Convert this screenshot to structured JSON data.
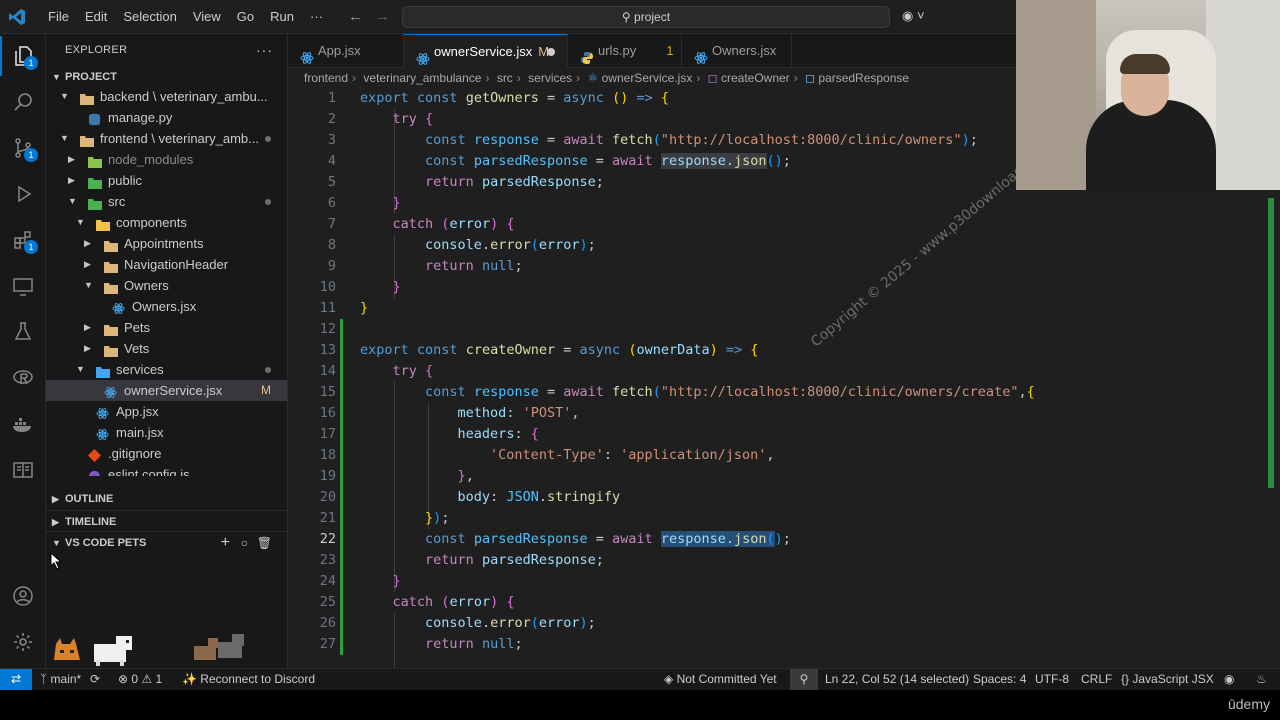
{
  "menu": {
    "items": [
      "File",
      "Edit",
      "Selection",
      "View",
      "Go",
      "Run"
    ],
    "more": "···"
  },
  "search": {
    "text": "project"
  },
  "colors": {
    "accent": "#0078d4",
    "git_added": "#2ea043",
    "modified": "#e2c08d"
  },
  "explorer": {
    "title": "EXPLORER",
    "more": "···",
    "project_section": "PROJECT",
    "outline": "OUTLINE",
    "timeline": "TIMELINE",
    "pets": "VS CODE PETS",
    "tree": [
      {
        "label": "backend \\ veterinary_ambu...",
        "depth": 0,
        "kind": "folder-open",
        "icon": "folder-icon"
      },
      {
        "label": "manage.py",
        "depth": 1,
        "kind": "file",
        "icon": "python-icon"
      },
      {
        "label": "frontend \\ veterinary_amb...",
        "depth": 0,
        "kind": "folder-open",
        "icon": "folder-icon"
      },
      {
        "label": "node_modules",
        "depth": 1,
        "kind": "folder-closed",
        "icon": "folder-node-icon"
      },
      {
        "label": "public",
        "depth": 1,
        "kind": "folder-closed",
        "icon": "folder-public-icon"
      },
      {
        "label": "src",
        "depth": 1,
        "kind": "folder-open",
        "icon": "folder-src-icon"
      },
      {
        "label": "components",
        "depth": 2,
        "kind": "folder-open",
        "icon": "folder-components-icon"
      },
      {
        "label": "Appointments",
        "depth": 3,
        "kind": "folder-closed",
        "icon": "folder-icon"
      },
      {
        "label": "NavigationHeader",
        "depth": 3,
        "kind": "folder-closed",
        "icon": "folder-icon"
      },
      {
        "label": "Owners",
        "depth": 3,
        "kind": "folder-open",
        "icon": "folder-icon"
      },
      {
        "label": "Owners.jsx",
        "depth": 4,
        "kind": "file",
        "icon": "react-icon"
      },
      {
        "label": "Pets",
        "depth": 3,
        "kind": "folder-closed",
        "icon": "folder-icon"
      },
      {
        "label": "Vets",
        "depth": 3,
        "kind": "folder-closed",
        "icon": "folder-icon"
      },
      {
        "label": "services",
        "depth": 2,
        "kind": "folder-open",
        "icon": "folder-services-icon"
      },
      {
        "label": "ownerService.jsx",
        "depth": 3,
        "kind": "file",
        "icon": "react-icon",
        "badge": "M"
      },
      {
        "label": "App.jsx",
        "depth": 2,
        "kind": "file",
        "icon": "react-icon"
      },
      {
        "label": "main.jsx",
        "depth": 2,
        "kind": "file",
        "icon": "react-icon"
      },
      {
        "label": ".gitignore",
        "depth": 1,
        "kind": "file",
        "icon": "git-icon"
      },
      {
        "label": "eslint.config.js",
        "depth": 1,
        "kind": "file",
        "icon": "eslint-icon"
      }
    ]
  },
  "tabs": [
    {
      "label": "App.jsx",
      "icon": "react-icon"
    },
    {
      "label": "ownerService.jsx",
      "icon": "react-icon",
      "badge": "M",
      "active": true
    },
    {
      "label": "urls.py",
      "icon": "python-icon",
      "count": "1"
    },
    {
      "label": "Owners.jsx",
      "icon": "react-icon"
    }
  ],
  "breadcrumb": [
    "frontend",
    "veterinary_ambulance",
    "src",
    "services",
    "ownerService.jsx",
    "createOwner",
    "parsedResponse"
  ],
  "editor": {
    "line_numbers": [
      "1",
      "2",
      "3",
      "4",
      "5",
      "6",
      "7",
      "8",
      "9",
      "10",
      "11",
      "12",
      "13",
      "14",
      "15",
      "16",
      "17",
      "18",
      "19",
      "20",
      "21",
      "22",
      "23",
      "24",
      "25",
      "26",
      "27"
    ],
    "current_line": "22"
  },
  "watermark": "Copyright © 2025 - www.p30download.com",
  "status": {
    "branch": "main*",
    "errors": "0",
    "warnings": "1",
    "discord": "Reconnect to Discord",
    "blame": "Not Committed Yet",
    "position": "Ln 22, Col 52 (14 selected)",
    "spaces": "Spaces: 4",
    "encoding": "UTF-8",
    "eol": "CRLF",
    "language": "JavaScript JSX"
  },
  "brand": "ūdemy"
}
